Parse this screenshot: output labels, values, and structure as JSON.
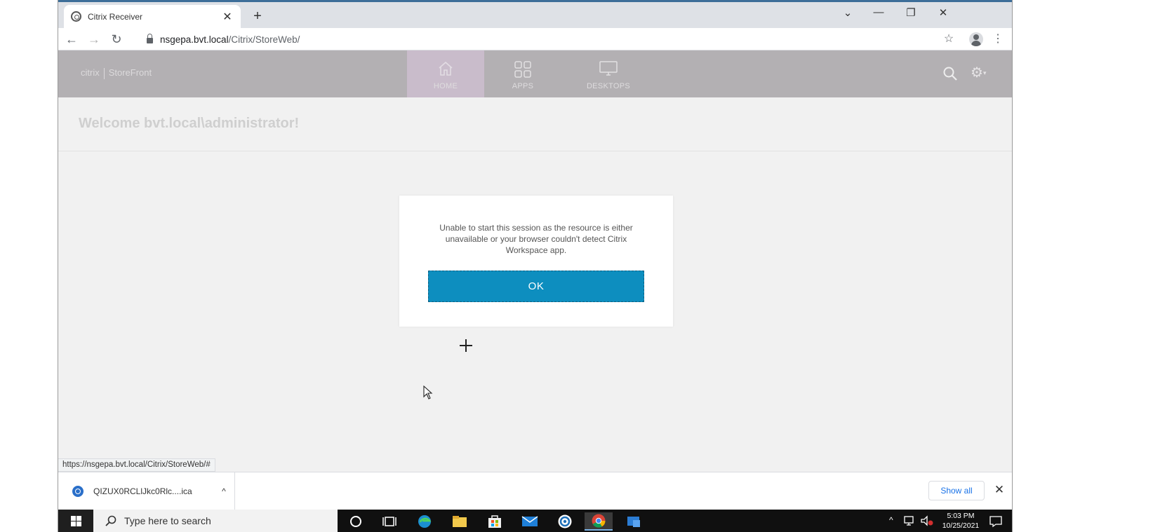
{
  "browser": {
    "tab_title": "Citrix Receiver",
    "tab_close": "✕",
    "new_tab": "+",
    "window_controls": {
      "dropdown": "⌄",
      "minimize": "—",
      "restore": "❐",
      "close": "✕"
    },
    "nav": {
      "back": "←",
      "forward": "→",
      "reload": "↻"
    },
    "url_host": "nsgepa.bvt.local",
    "url_path": "/Citrix/StoreWeb/",
    "bookmark_star": "☆",
    "menu": "⋮",
    "status_url": "https://nsgepa.bvt.local/Citrix/StoreWeb/#"
  },
  "storefront": {
    "logo_brand": "citrix",
    "logo_product": "StoreFront",
    "tabs": [
      {
        "label": "HOME",
        "icon": "home-icon",
        "active": true
      },
      {
        "label": "APPS",
        "icon": "apps-grid-icon",
        "active": false
      },
      {
        "label": "DESKTOPS",
        "icon": "desktop-monitor-icon",
        "active": false
      }
    ],
    "welcome": "Welcome bvt.local\\administrator!",
    "gear_caret": "▾"
  },
  "dialog": {
    "message": "Unable to start this session as the resource is either unavailable or your browser couldn't detect Citrix Workspace app.",
    "ok_label": "OK"
  },
  "downloads": {
    "file_name": "QIZUX0RCLlJkc0Rlc....ica",
    "chevron": "^",
    "show_all": "Show all",
    "close": "✕"
  },
  "taskbar": {
    "search_placeholder": "Type here to search",
    "apps": [
      "cortana-circle-icon",
      "task-view-icon",
      "edge-icon",
      "file-explorer-icon",
      "store-icon",
      "mail-icon",
      "citrix-icon",
      "chrome-icon",
      "remote-app-icon"
    ],
    "time": "5:03 PM",
    "date": "10/25/2021",
    "tray_chevron": "^"
  },
  "colors": {
    "ok_button": "#0d8ebf",
    "storefront_header": "#b3b0b3",
    "active_tab": "#c9bccb",
    "taskbar": "#101010"
  }
}
